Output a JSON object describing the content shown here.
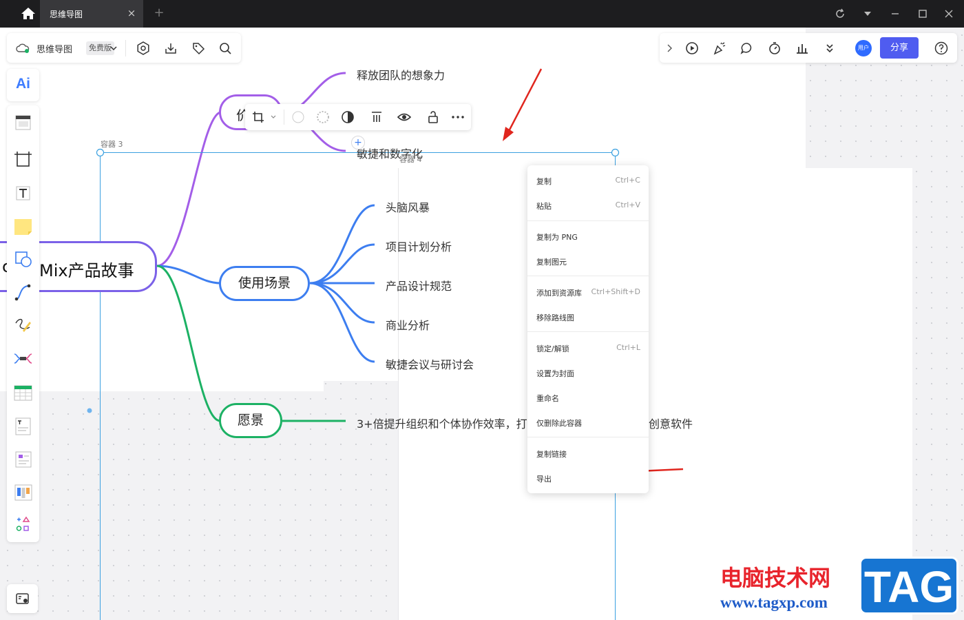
{
  "titlebar": {
    "tab_title": "思维导图",
    "tab_close": "×",
    "tab_add": "+"
  },
  "top_left_toolbar": {
    "doc_name": "思维导图",
    "plan_badge": "免费版"
  },
  "top_right_toolbar": {
    "avatar_text": "用户",
    "share_label": "分享"
  },
  "left_toolbar": {
    "ai_label": "Ai"
  },
  "mindmap": {
    "root": "Mix产品故事",
    "root_partial_prefix": "c",
    "branch_values_partial": "价",
    "branch_scenarios": "使用场景",
    "branch_vision": "愿景",
    "values_children": [
      "释放团队的想象力",
      "敏捷和数字化"
    ],
    "scenario_children": [
      "头脑风暴",
      "项目计划分析",
      "产品设计规范",
      "商业分析",
      "敏捷会议与研讨会"
    ],
    "vision_child_left": "3+倍提升组织和个体协作效率，打",
    "vision_child_right": "创意软件",
    "add_child_symbol": "+"
  },
  "containers": {
    "container_3_label": "容器 3",
    "container_4_label": "容器 4"
  },
  "context_menu": {
    "items": [
      {
        "label": "复制",
        "shortcut": "Ctrl+C"
      },
      {
        "label": "粘贴",
        "shortcut": "Ctrl+V"
      },
      {
        "label": "复制为 PNG",
        "shortcut": ""
      },
      {
        "label": "复制图元",
        "shortcut": ""
      },
      {
        "label": "添加到资源库",
        "shortcut": "Ctrl+Shift+D"
      },
      {
        "label": "移除路线图",
        "shortcut": ""
      },
      {
        "label": "锁定/解锁",
        "shortcut": "Ctrl+L"
      },
      {
        "label": "设置为封面",
        "shortcut": ""
      },
      {
        "label": "重命名",
        "shortcut": ""
      },
      {
        "label": "仅删除此容器",
        "shortcut": ""
      },
      {
        "label": "复制链接",
        "shortcut": ""
      },
      {
        "label": "导出",
        "shortcut": ""
      }
    ]
  },
  "watermark": {
    "title": "电脑技术网",
    "url": "www.tagxp.com",
    "tag": "TAG"
  },
  "colors": {
    "purple_branch": "#a35ee8",
    "blue_branch": "#3d7ef0",
    "green_branch": "#1cb164",
    "selection": "#3aa0e0",
    "annotation_arrow": "#e0261e",
    "share_button": "#4f5cf0"
  }
}
